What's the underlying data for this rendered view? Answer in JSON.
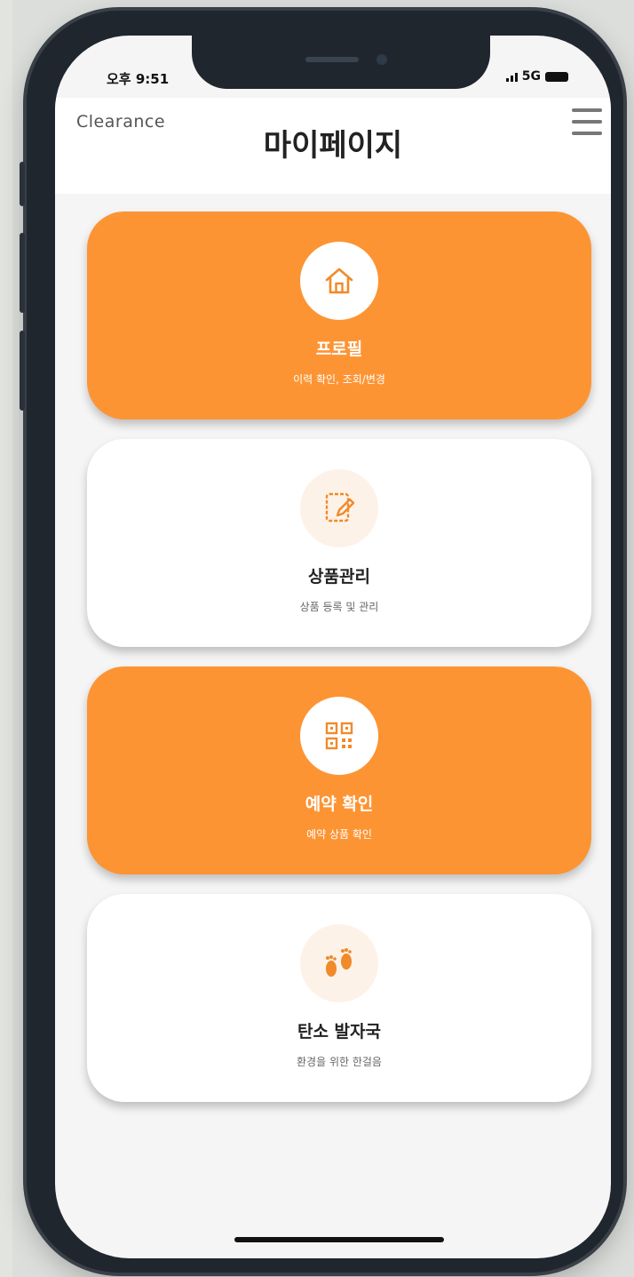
{
  "status_bar": {
    "time": "오후 9:51",
    "network": "5G",
    "signal_icon": "signal-bars-icon",
    "battery_icon": "battery-icon"
  },
  "header": {
    "logo": "Clearance",
    "title": "마이페이지",
    "menu_icon": "hamburger-menu-icon"
  },
  "menu_cards": [
    {
      "icon": "home-icon",
      "title": "프로필",
      "subtitle": "이력 확인, 조회/변경",
      "style": "orange"
    },
    {
      "icon": "edit-document-icon",
      "title": "상품관리",
      "subtitle": "상품 등록 및 관리",
      "style": "white"
    },
    {
      "icon": "qr-code-icon",
      "title": "예약 확인",
      "subtitle": "예약 상품 확인",
      "style": "orange"
    },
    {
      "icon": "footprints-icon",
      "title": "탄소 발자국",
      "subtitle": "환경을 위한 한걸음",
      "style": "white"
    }
  ],
  "colors": {
    "accent": "#fd9434",
    "card_white": "#ffffff",
    "screen_bg": "#f5f5f5",
    "phone_frame": "#1f262d"
  }
}
